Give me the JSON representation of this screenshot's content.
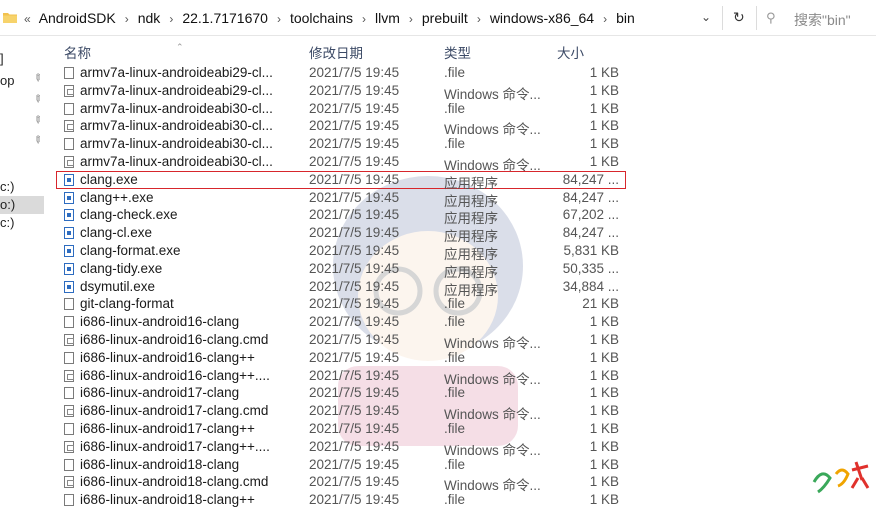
{
  "address_bar": {
    "collapsed": "«",
    "crumbs": [
      "AndroidSDK",
      "ndk",
      "22.1.7171670",
      "toolchains",
      "llvm",
      "prebuilt",
      "windows-x86_64",
      "bin"
    ],
    "dropdown_icon": "chevron-down-icon",
    "refresh_icon": "refresh-icon"
  },
  "search": {
    "placeholder": "搜索\"bin\""
  },
  "nav": {
    "items": [
      {
        "label": "]",
        "pinned": false
      },
      {
        "label": "op",
        "pinned": true
      },
      {
        "label": "",
        "pinned": true
      },
      {
        "label": "",
        "pinned": true
      },
      {
        "label": "",
        "pinned": true
      },
      {
        "label": "c:)",
        "pinned": false
      },
      {
        "label": "o:)",
        "pinned": false,
        "selected": true
      },
      {
        "label": "c:)",
        "pinned": false
      }
    ]
  },
  "columns": {
    "name": "名称",
    "date": "修改日期",
    "type": "类型",
    "size": "大小"
  },
  "files": [
    {
      "name": "armv7a-linux-androideabi29-cl...",
      "date": "2021/7/5 19:45",
      "type": ".file",
      "size": "1 KB",
      "icon": "file"
    },
    {
      "name": "armv7a-linux-androideabi29-cl...",
      "date": "2021/7/5 19:45",
      "type": "Windows 命令...",
      "size": "1 KB",
      "icon": "cmd"
    },
    {
      "name": "armv7a-linux-androideabi30-cl...",
      "date": "2021/7/5 19:45",
      "type": ".file",
      "size": "1 KB",
      "icon": "file"
    },
    {
      "name": "armv7a-linux-androideabi30-cl...",
      "date": "2021/7/5 19:45",
      "type": "Windows 命令...",
      "size": "1 KB",
      "icon": "cmd"
    },
    {
      "name": "armv7a-linux-androideabi30-cl...",
      "date": "2021/7/5 19:45",
      "type": ".file",
      "size": "1 KB",
      "icon": "file"
    },
    {
      "name": "armv7a-linux-androideabi30-cl...",
      "date": "2021/7/5 19:45",
      "type": "Windows 命令...",
      "size": "1 KB",
      "icon": "cmd"
    },
    {
      "name": "clang.exe",
      "date": "2021/7/5 19:45",
      "type": "应用程序",
      "size": "84,247 ...",
      "icon": "exe",
      "highlighted": true
    },
    {
      "name": "clang++.exe",
      "date": "2021/7/5 19:45",
      "type": "应用程序",
      "size": "84,247 ...",
      "icon": "exe"
    },
    {
      "name": "clang-check.exe",
      "date": "2021/7/5 19:45",
      "type": "应用程序",
      "size": "67,202 ...",
      "icon": "exe"
    },
    {
      "name": "clang-cl.exe",
      "date": "2021/7/5 19:45",
      "type": "应用程序",
      "size": "84,247 ...",
      "icon": "exe"
    },
    {
      "name": "clang-format.exe",
      "date": "2021/7/5 19:45",
      "type": "应用程序",
      "size": "5,831 KB",
      "icon": "exe"
    },
    {
      "name": "clang-tidy.exe",
      "date": "2021/7/5 19:45",
      "type": "应用程序",
      "size": "50,335 ...",
      "icon": "exe"
    },
    {
      "name": "dsymutil.exe",
      "date": "2021/7/5 19:45",
      "type": "应用程序",
      "size": "34,884 ...",
      "icon": "exe"
    },
    {
      "name": "git-clang-format",
      "date": "2021/7/5 19:45",
      "type": ".file",
      "size": "21 KB",
      "icon": "file"
    },
    {
      "name": "i686-linux-android16-clang",
      "date": "2021/7/5 19:45",
      "type": ".file",
      "size": "1 KB",
      "icon": "file"
    },
    {
      "name": "i686-linux-android16-clang.cmd",
      "date": "2021/7/5 19:45",
      "type": "Windows 命令...",
      "size": "1 KB",
      "icon": "cmd"
    },
    {
      "name": "i686-linux-android16-clang++",
      "date": "2021/7/5 19:45",
      "type": ".file",
      "size": "1 KB",
      "icon": "file"
    },
    {
      "name": "i686-linux-android16-clang++....",
      "date": "2021/7/5 19:45",
      "type": "Windows 命令...",
      "size": "1 KB",
      "icon": "cmd"
    },
    {
      "name": "i686-linux-android17-clang",
      "date": "2021/7/5 19:45",
      "type": ".file",
      "size": "1 KB",
      "icon": "file"
    },
    {
      "name": "i686-linux-android17-clang.cmd",
      "date": "2021/7/5 19:45",
      "type": "Windows 命令...",
      "size": "1 KB",
      "icon": "cmd"
    },
    {
      "name": "i686-linux-android17-clang++",
      "date": "2021/7/5 19:45",
      "type": ".file",
      "size": "1 KB",
      "icon": "file"
    },
    {
      "name": "i686-linux-android17-clang++....",
      "date": "2021/7/5 19:45",
      "type": "Windows 命令...",
      "size": "1 KB",
      "icon": "cmd"
    },
    {
      "name": "i686-linux-android18-clang",
      "date": "2021/7/5 19:45",
      "type": ".file",
      "size": "1 KB",
      "icon": "file"
    },
    {
      "name": "i686-linux-android18-clang.cmd",
      "date": "2021/7/5 19:45",
      "type": "Windows 命令...",
      "size": "1 KB",
      "icon": "cmd"
    },
    {
      "name": "i686-linux-android18-clang++",
      "date": "2021/7/5 19:45",
      "type": ".file",
      "size": "1 KB",
      "icon": "file"
    }
  ],
  "colors": {
    "highlight_border": "#d7262c",
    "exe_icon": "#2d6cc0",
    "header_text": "#3c4a66"
  }
}
